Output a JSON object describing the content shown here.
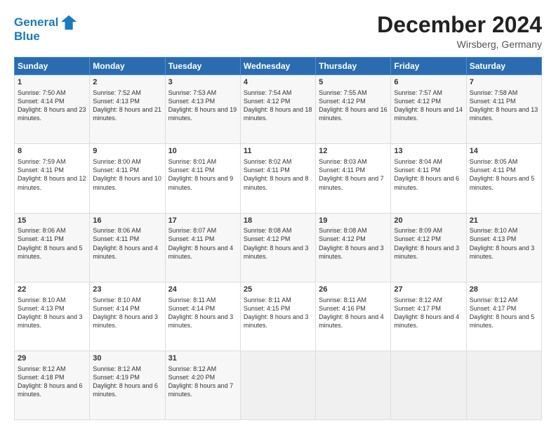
{
  "header": {
    "logo_line1": "General",
    "logo_line2": "Blue",
    "month_title": "December 2024",
    "location": "Wirsberg, Germany"
  },
  "days_of_week": [
    "Sunday",
    "Monday",
    "Tuesday",
    "Wednesday",
    "Thursday",
    "Friday",
    "Saturday"
  ],
  "weeks": [
    [
      {
        "day": "1",
        "sunrise": "Sunrise: 7:50 AM",
        "sunset": "Sunset: 4:14 PM",
        "daylight": "Daylight: 8 hours and 23 minutes."
      },
      {
        "day": "2",
        "sunrise": "Sunrise: 7:52 AM",
        "sunset": "Sunset: 4:13 PM",
        "daylight": "Daylight: 8 hours and 21 minutes."
      },
      {
        "day": "3",
        "sunrise": "Sunrise: 7:53 AM",
        "sunset": "Sunset: 4:13 PM",
        "daylight": "Daylight: 8 hours and 19 minutes."
      },
      {
        "day": "4",
        "sunrise": "Sunrise: 7:54 AM",
        "sunset": "Sunset: 4:12 PM",
        "daylight": "Daylight: 8 hours and 18 minutes."
      },
      {
        "day": "5",
        "sunrise": "Sunrise: 7:55 AM",
        "sunset": "Sunset: 4:12 PM",
        "daylight": "Daylight: 8 hours and 16 minutes."
      },
      {
        "day": "6",
        "sunrise": "Sunrise: 7:57 AM",
        "sunset": "Sunset: 4:12 PM",
        "daylight": "Daylight: 8 hours and 14 minutes."
      },
      {
        "day": "7",
        "sunrise": "Sunrise: 7:58 AM",
        "sunset": "Sunset: 4:11 PM",
        "daylight": "Daylight: 8 hours and 13 minutes."
      }
    ],
    [
      {
        "day": "8",
        "sunrise": "Sunrise: 7:59 AM",
        "sunset": "Sunset: 4:11 PM",
        "daylight": "Daylight: 8 hours and 12 minutes."
      },
      {
        "day": "9",
        "sunrise": "Sunrise: 8:00 AM",
        "sunset": "Sunset: 4:11 PM",
        "daylight": "Daylight: 8 hours and 10 minutes."
      },
      {
        "day": "10",
        "sunrise": "Sunrise: 8:01 AM",
        "sunset": "Sunset: 4:11 PM",
        "daylight": "Daylight: 8 hours and 9 minutes."
      },
      {
        "day": "11",
        "sunrise": "Sunrise: 8:02 AM",
        "sunset": "Sunset: 4:11 PM",
        "daylight": "Daylight: 8 hours and 8 minutes."
      },
      {
        "day": "12",
        "sunrise": "Sunrise: 8:03 AM",
        "sunset": "Sunset: 4:11 PM",
        "daylight": "Daylight: 8 hours and 7 minutes."
      },
      {
        "day": "13",
        "sunrise": "Sunrise: 8:04 AM",
        "sunset": "Sunset: 4:11 PM",
        "daylight": "Daylight: 8 hours and 6 minutes."
      },
      {
        "day": "14",
        "sunrise": "Sunrise: 8:05 AM",
        "sunset": "Sunset: 4:11 PM",
        "daylight": "Daylight: 8 hours and 5 minutes."
      }
    ],
    [
      {
        "day": "15",
        "sunrise": "Sunrise: 8:06 AM",
        "sunset": "Sunset: 4:11 PM",
        "daylight": "Daylight: 8 hours and 5 minutes."
      },
      {
        "day": "16",
        "sunrise": "Sunrise: 8:06 AM",
        "sunset": "Sunset: 4:11 PM",
        "daylight": "Daylight: 8 hours and 4 minutes."
      },
      {
        "day": "17",
        "sunrise": "Sunrise: 8:07 AM",
        "sunset": "Sunset: 4:11 PM",
        "daylight": "Daylight: 8 hours and 4 minutes."
      },
      {
        "day": "18",
        "sunrise": "Sunrise: 8:08 AM",
        "sunset": "Sunset: 4:12 PM",
        "daylight": "Daylight: 8 hours and 3 minutes."
      },
      {
        "day": "19",
        "sunrise": "Sunrise: 8:08 AM",
        "sunset": "Sunset: 4:12 PM",
        "daylight": "Daylight: 8 hours and 3 minutes."
      },
      {
        "day": "20",
        "sunrise": "Sunrise: 8:09 AM",
        "sunset": "Sunset: 4:12 PM",
        "daylight": "Daylight: 8 hours and 3 minutes."
      },
      {
        "day": "21",
        "sunrise": "Sunrise: 8:10 AM",
        "sunset": "Sunset: 4:13 PM",
        "daylight": "Daylight: 8 hours and 3 minutes."
      }
    ],
    [
      {
        "day": "22",
        "sunrise": "Sunrise: 8:10 AM",
        "sunset": "Sunset: 4:13 PM",
        "daylight": "Daylight: 8 hours and 3 minutes."
      },
      {
        "day": "23",
        "sunrise": "Sunrise: 8:10 AM",
        "sunset": "Sunset: 4:14 PM",
        "daylight": "Daylight: 8 hours and 3 minutes."
      },
      {
        "day": "24",
        "sunrise": "Sunrise: 8:11 AM",
        "sunset": "Sunset: 4:14 PM",
        "daylight": "Daylight: 8 hours and 3 minutes."
      },
      {
        "day": "25",
        "sunrise": "Sunrise: 8:11 AM",
        "sunset": "Sunset: 4:15 PM",
        "daylight": "Daylight: 8 hours and 3 minutes."
      },
      {
        "day": "26",
        "sunrise": "Sunrise: 8:11 AM",
        "sunset": "Sunset: 4:16 PM",
        "daylight": "Daylight: 8 hours and 4 minutes."
      },
      {
        "day": "27",
        "sunrise": "Sunrise: 8:12 AM",
        "sunset": "Sunset: 4:17 PM",
        "daylight": "Daylight: 8 hours and 4 minutes."
      },
      {
        "day": "28",
        "sunrise": "Sunrise: 8:12 AM",
        "sunset": "Sunset: 4:17 PM",
        "daylight": "Daylight: 8 hours and 5 minutes."
      }
    ],
    [
      {
        "day": "29",
        "sunrise": "Sunrise: 8:12 AM",
        "sunset": "Sunset: 4:18 PM",
        "daylight": "Daylight: 8 hours and 6 minutes."
      },
      {
        "day": "30",
        "sunrise": "Sunrise: 8:12 AM",
        "sunset": "Sunset: 4:19 PM",
        "daylight": "Daylight: 8 hours and 6 minutes."
      },
      {
        "day": "31",
        "sunrise": "Sunrise: 8:12 AM",
        "sunset": "Sunset: 4:20 PM",
        "daylight": "Daylight: 8 hours and 7 minutes."
      },
      null,
      null,
      null,
      null
    ]
  ]
}
